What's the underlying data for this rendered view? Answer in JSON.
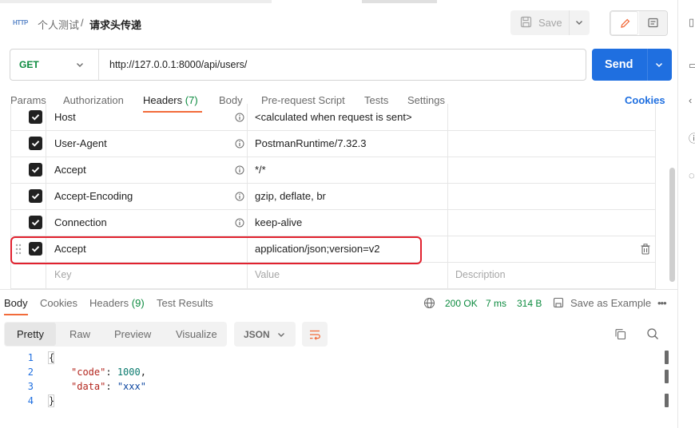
{
  "breadcrumb": {
    "app_icon": "http-icon",
    "app_icon_text": "HTTP",
    "parent": "个人测试",
    "separator": "/",
    "current": "请求头传递"
  },
  "toolbar": {
    "save_label": "Save"
  },
  "request": {
    "method": "GET",
    "url": "http://127.0.0.1:8000/api/users/",
    "send_label": "Send"
  },
  "request_tabs": [
    {
      "label": "Params"
    },
    {
      "label": "Authorization"
    },
    {
      "label": "Headers",
      "count": "(7)",
      "active": true
    },
    {
      "label": "Body"
    },
    {
      "label": "Pre-request Script"
    },
    {
      "label": "Tests"
    },
    {
      "label": "Settings"
    }
  ],
  "cookies_link": "Cookies",
  "headers": [
    {
      "key": "Host",
      "value": "<calculated when request is sent>",
      "checked": true,
      "auto": true
    },
    {
      "key": "User-Agent",
      "value": "PostmanRuntime/7.32.3",
      "checked": true,
      "auto": true
    },
    {
      "key": "Accept",
      "value": "*/*",
      "checked": true,
      "auto": true
    },
    {
      "key": "Accept-Encoding",
      "value": "gzip, deflate, br",
      "checked": true,
      "auto": true
    },
    {
      "key": "Connection",
      "value": "keep-alive",
      "checked": true,
      "auto": true
    },
    {
      "key": "Accept",
      "value": "application/json;version=v2",
      "checked": true,
      "auto": false
    }
  ],
  "new_row": {
    "key_placeholder": "Key",
    "value_placeholder": "Value",
    "description_placeholder": "Description"
  },
  "response_tabs": [
    {
      "label": "Body",
      "active": true
    },
    {
      "label": "Cookies"
    },
    {
      "label": "Headers",
      "count": "(9)"
    },
    {
      "label": "Test Results"
    }
  ],
  "response_status": {
    "code": "200 OK",
    "time": "7 ms",
    "size": "314 B",
    "save_example": "Save as Example",
    "more": "•••"
  },
  "view_tabs": [
    {
      "label": "Pretty",
      "active": true
    },
    {
      "label": "Raw"
    },
    {
      "label": "Preview"
    },
    {
      "label": "Visualize"
    }
  ],
  "format_select": "JSON",
  "code_lines": [
    {
      "num": "1",
      "text": "{"
    },
    {
      "num": "2",
      "key": "\"code\"",
      "sep": ": ",
      "value": "1000",
      "end": ","
    },
    {
      "num": "3",
      "key": "\"data\"",
      "sep": ": ",
      "value": "\"xxx\"",
      "end": ""
    },
    {
      "num": "4",
      "text": "}"
    }
  ],
  "colors": {
    "accent": "#f26b3a",
    "primary": "#1f6fe0",
    "success": "#0b8a3e",
    "highlight": "#e1222f"
  }
}
